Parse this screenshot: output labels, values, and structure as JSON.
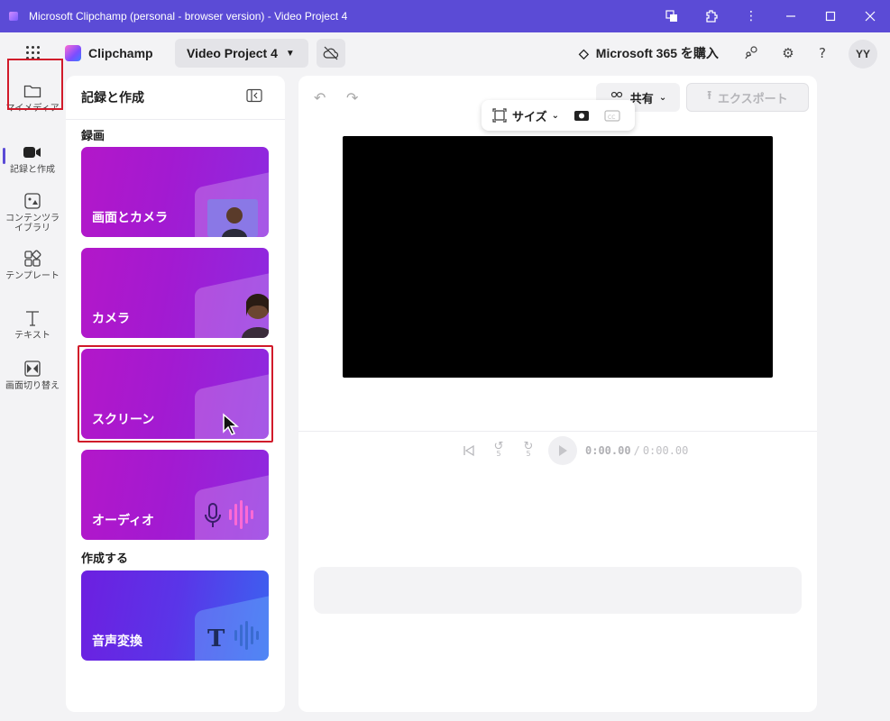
{
  "window": {
    "title": "Microsoft Clipchamp (personal - browser version) - Video Project 4",
    "buttons": [
      "translate-icon",
      "extension-icon",
      "more-icon",
      "minimize-icon",
      "maximize-icon",
      "close-icon"
    ]
  },
  "header": {
    "brand": "Clipchamp",
    "project_name": "Video Project 4",
    "buy_label": "Microsoft 365 を購入",
    "avatar_initials": "YY"
  },
  "leftnav": {
    "items": [
      {
        "label": "マイメディア",
        "icon": "folder-icon"
      },
      {
        "label": "記録と作成",
        "icon": "video-camera-icon"
      },
      {
        "label": "コンテンツライブラリ",
        "icon": "content-library-icon"
      },
      {
        "label": "テンプレート",
        "icon": "templates-icon"
      },
      {
        "label": "テキスト",
        "icon": "text-icon"
      },
      {
        "label": "画面切り替え",
        "icon": "transitions-icon"
      }
    ],
    "active_index": 1
  },
  "panel": {
    "title": "記録と作成",
    "section_record": "録画",
    "section_create": "作成する",
    "cards": [
      {
        "label": "画面とカメラ"
      },
      {
        "label": "カメラ"
      },
      {
        "label": "スクリーン"
      },
      {
        "label": "オーディオ"
      },
      {
        "label": "音声変換"
      }
    ]
  },
  "main": {
    "share_label": "共有",
    "export_label": "エクスポート",
    "size_label": "サイズ",
    "time_current": "0:00.00",
    "time_separator": "/",
    "time_total": "0:00.00",
    "skip_seconds": "5"
  },
  "colors": {
    "titlebar": "#5b4bd6",
    "accent": "#5b4bd6",
    "highlight_border": "#d11a2a",
    "card_gradient_start": "#b317c9",
    "card_gradient_end": "#8d2ae0"
  }
}
